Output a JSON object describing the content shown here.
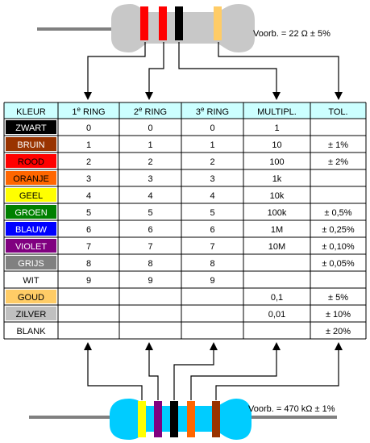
{
  "headers": [
    "KLEUR",
    "1",
    "e",
    " RING",
    "2",
    "e",
    " RING",
    "3",
    "e",
    " RING",
    "MULTIPL.",
    "TOL."
  ],
  "header_cells": [
    {
      "main": "KLEUR"
    },
    {
      "pre": "1",
      "sup": "e",
      "post": " RING"
    },
    {
      "pre": "2",
      "sup": "e",
      "post": " RING"
    },
    {
      "pre": "3",
      "sup": "e",
      "post": " RING"
    },
    {
      "main": "MULTIPL."
    },
    {
      "main": "TOL."
    }
  ],
  "rows": [
    {
      "name": "ZWART",
      "color": "#000000",
      "text_color": "#ffffff",
      "r1": "0",
      "r2": "0",
      "r3": "0",
      "mult": "1",
      "tol": ""
    },
    {
      "name": "BRUIN",
      "color": "#993300",
      "text_color": "#ffffff",
      "r1": "1",
      "r2": "1",
      "r3": "1",
      "mult": "10",
      "tol": "± 1%"
    },
    {
      "name": "ROOD",
      "color": "#ff0000",
      "text_color": "#000000",
      "r1": "2",
      "r2": "2",
      "r3": "2",
      "mult": "100",
      "tol": "± 2%"
    },
    {
      "name": "ORANJE",
      "color": "#ff6600",
      "text_color": "#000000",
      "r1": "3",
      "r2": "3",
      "r3": "3",
      "mult": "1k",
      "tol": ""
    },
    {
      "name": "GEEL",
      "color": "#ffff00",
      "text_color": "#000000",
      "r1": "4",
      "r2": "4",
      "r3": "4",
      "mult": "10k",
      "tol": ""
    },
    {
      "name": "GROEN",
      "color": "#008000",
      "text_color": "#ffffff",
      "r1": "5",
      "r2": "5",
      "r3": "5",
      "mult": "100k",
      "tol": "± 0,5%"
    },
    {
      "name": "BLAUW",
      "color": "#0000ff",
      "text_color": "#ffffff",
      "r1": "6",
      "r2": "6",
      "r3": "6",
      "mult": "1M",
      "tol": "± 0,25%"
    },
    {
      "name": "VIOLET",
      "color": "#800080",
      "text_color": "#ffffff",
      "r1": "7",
      "r2": "7",
      "r3": "7",
      "mult": "10M",
      "tol": "± 0,10%"
    },
    {
      "name": "GRIJS",
      "color": "#808080",
      "text_color": "#ffffff",
      "r1": "8",
      "r2": "8",
      "r3": "8",
      "mult": "",
      "tol": "± 0,05%"
    },
    {
      "name": "WIT",
      "color": "#ffffff",
      "text_color": "#000000",
      "r1": "9",
      "r2": "9",
      "r3": "9",
      "mult": "",
      "tol": ""
    },
    {
      "name": "GOUD",
      "color": "#ffcc66",
      "text_color": "#000000",
      "r1": "",
      "r2": "",
      "r3": "",
      "mult": "0,1",
      "tol": "±  5%"
    },
    {
      "name": "ZILVER",
      "color": "#c0c0c0",
      "text_color": "#000000",
      "r1": "",
      "r2": "",
      "r3": "",
      "mult": "0,01",
      "tol": "± 10%"
    },
    {
      "name": "BLANK",
      "color": "#ffffff",
      "text_color": "#000000",
      "r1": "",
      "r2": "",
      "r3": "",
      "mult": "",
      "tol": "± 20%"
    }
  ],
  "top_resistor": {
    "label": "Voorb. = 22 Ω  ± 5%",
    "band_colors": [
      "#ff0000",
      "#ff0000",
      "#000000",
      "#ffcc66"
    ],
    "body_color": "#c8c8c8"
  },
  "bottom_resistor": {
    "label": "Voorb. = 470 kΩ  ± 1%",
    "band_colors": [
      "#ffff00",
      "#800080",
      "#000000",
      "#ff6600",
      "#993300"
    ],
    "body_color": "#00ccff"
  },
  "colors": {
    "header_bg": "#ccffff",
    "grid": "#000000",
    "lead": "#808080",
    "arrow": "#000000"
  }
}
